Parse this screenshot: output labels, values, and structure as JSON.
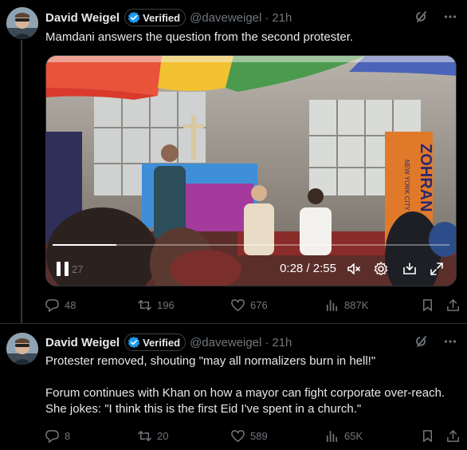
{
  "tweets": [
    {
      "author_name": "David Weigel",
      "verified_label": "Verified",
      "handle": "@daveweigel",
      "time": "21h",
      "text_paragraphs": [
        "Mamdani answers the question from the second protester."
      ],
      "video": {
        "current_time": "0:28",
        "separator": "/",
        "duration": "2:55",
        "progress_fraction": 0.16,
        "faint_time": "27"
      },
      "stats": {
        "replies": "48",
        "reposts": "196",
        "likes": "676",
        "views": "887K"
      }
    },
    {
      "author_name": "David Weigel",
      "verified_label": "Verified",
      "handle": "@daveweigel",
      "time": "21h",
      "text_paragraphs": [
        "Protester removed, shouting \"may all normalizers burn in hell!\"",
        "Forum continues with Khan on how a mayor can fight corporate over-reach. She jokes: \"I think this is the first Eid I've spent in a church.\""
      ],
      "stats": {
        "replies": "8",
        "reposts": "20",
        "likes": "589",
        "views": "65K"
      }
    }
  ],
  "colors": {
    "background": "#000000",
    "text": "#e7e9ea",
    "muted": "#71767b",
    "verified_blue": "#1d9bf0",
    "divider": "#2f3336"
  },
  "banner_text": "ZOHRAN",
  "banner_subtext": "NEW YORK CITY"
}
